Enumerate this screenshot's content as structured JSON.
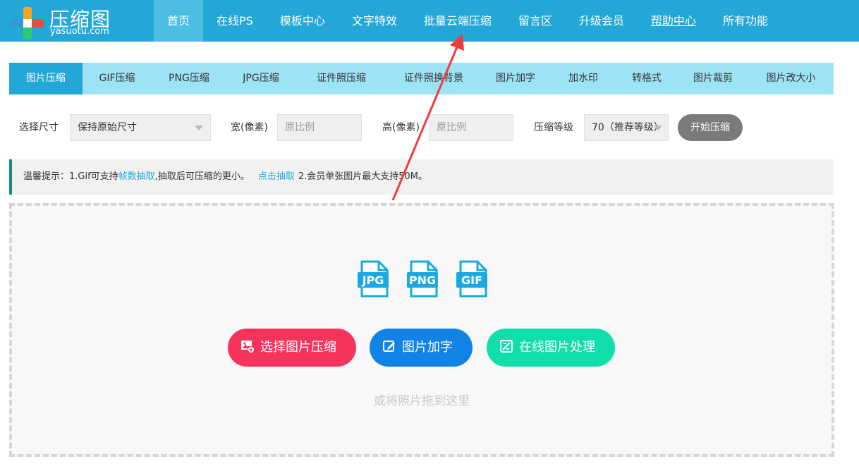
{
  "brand": {
    "name": "压缩图",
    "domain": "yasuotu.com"
  },
  "topnav": [
    {
      "label": "首页",
      "active": true,
      "underline": false
    },
    {
      "label": "在线PS",
      "active": false,
      "underline": false
    },
    {
      "label": "模板中心",
      "active": false,
      "underline": false
    },
    {
      "label": "文字特效",
      "active": false,
      "underline": false
    },
    {
      "label": "批量云端压缩",
      "active": false,
      "underline": false
    },
    {
      "label": "留言区",
      "active": false,
      "underline": false
    },
    {
      "label": "升级会员",
      "active": false,
      "underline": false
    },
    {
      "label": "帮助中心",
      "active": false,
      "underline": true
    },
    {
      "label": "所有功能",
      "active": false,
      "underline": false
    }
  ],
  "subtabs": [
    {
      "label": "图片压缩",
      "active": true
    },
    {
      "label": "GIF压缩",
      "active": false
    },
    {
      "label": "PNG压缩",
      "active": false
    },
    {
      "label": "JPG压缩",
      "active": false
    },
    {
      "label": "证件照压缩",
      "active": false
    },
    {
      "label": "证件照换背景",
      "active": false
    },
    {
      "label": "图片加字",
      "active": false
    },
    {
      "label": "加水印",
      "active": false
    },
    {
      "label": "转格式",
      "active": false
    },
    {
      "label": "图片裁剪",
      "active": false
    },
    {
      "label": "图片改大小",
      "active": false
    }
  ],
  "options": {
    "size_label": "选择尺寸",
    "size_value": "保持原始尺寸",
    "width_label": "宽(像素)",
    "width_placeholder": "原比例",
    "height_label": "高(像素)",
    "height_placeholder": "原比例",
    "level_label": "压缩等级",
    "level_value": "70（推荐等级）",
    "start_button": "开始压缩"
  },
  "notice": {
    "prefix": "温馨提示：1.Gif可支持",
    "link1": "帧数抽取",
    "middle": ",抽取后可压缩的更小。",
    "link2": "点击抽取",
    "suffix": "2.会员单张图片最大支持50M。"
  },
  "dropzone": {
    "formats": [
      "JPG",
      "PNG",
      "GIF"
    ],
    "buttons": {
      "select": "选择图片压缩",
      "add_text": "图片加字",
      "online": "在线图片处理"
    },
    "hint": "或将照片拖到这里"
  },
  "colors": {
    "brand_blue": "#22a7d6",
    "subtab_bg": "#9ee3f5",
    "red": "#f5345e",
    "blue": "#1283e6",
    "green": "#10dfac",
    "format_icon": "#1aa8e0",
    "arrow": "#ef3b3b"
  }
}
